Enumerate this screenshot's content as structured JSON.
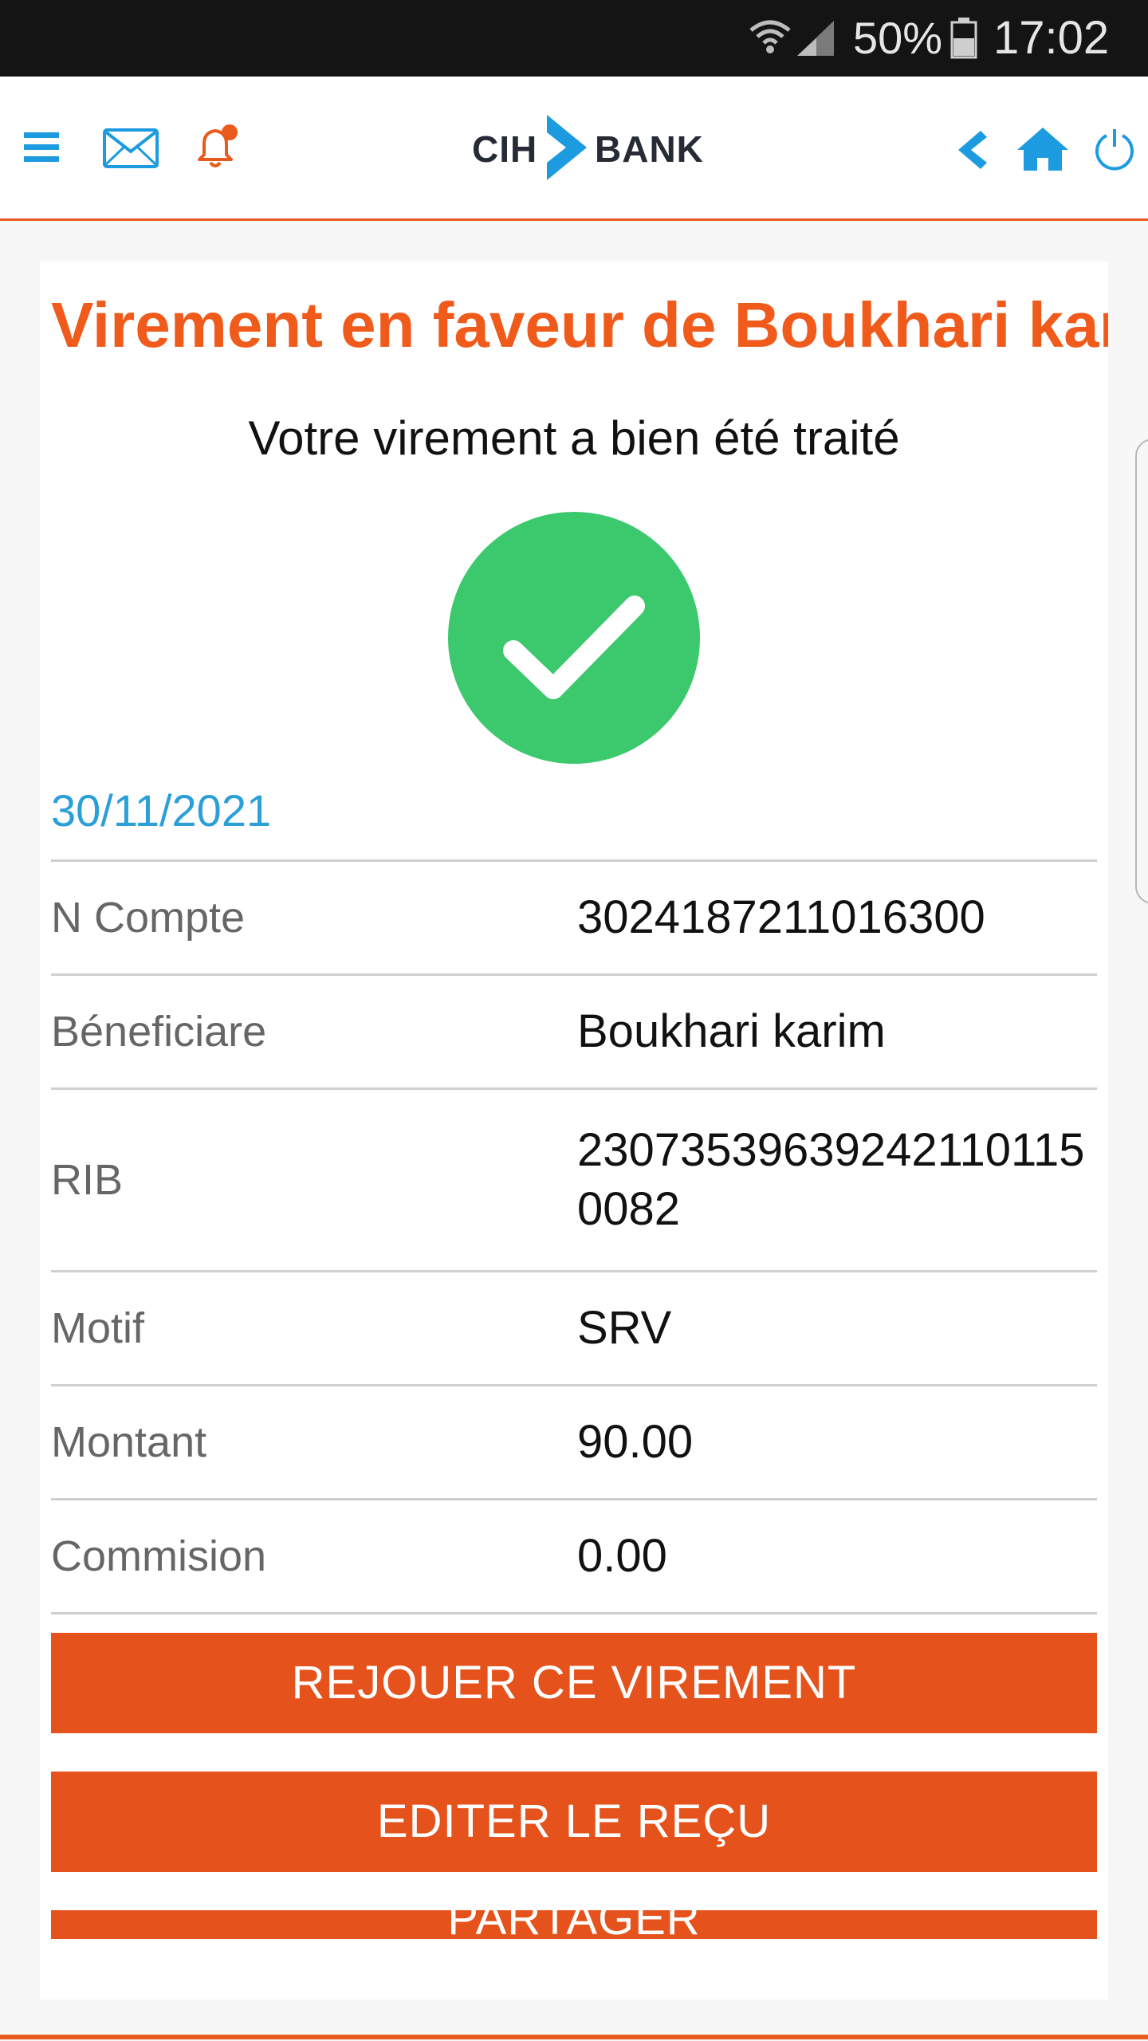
{
  "status_bar": {
    "battery": "50%",
    "time": "17:02",
    "icons": [
      "wifi-icon",
      "signal-icon",
      "battery-icon"
    ]
  },
  "header": {
    "logo_left": "CIH",
    "logo_right": "BANK",
    "icons": [
      "menu-icon",
      "mail-icon",
      "notification-bell-icon",
      "back-arrow-icon",
      "home-icon",
      "power-icon"
    ],
    "colors": {
      "accent_orange": "#e95a1c",
      "icon_blue": "#1d9be0"
    }
  },
  "transfer": {
    "title": "Virement en faveur de Boukhari karim",
    "confirmation": "Votre virement a bien été traité",
    "date": "30/11/2021",
    "rows": [
      {
        "label": "N Compte",
        "value": "3024187211016300"
      },
      {
        "label": "Béneficiare",
        "value": "Boukhari karim"
      },
      {
        "label": "RIB",
        "value": "230735396392421101150082"
      },
      {
        "label": "Motif",
        "value": "SRV"
      },
      {
        "label": "Montant",
        "value": "90.00"
      },
      {
        "label": "Commision",
        "value": "0.00"
      }
    ]
  },
  "actions": {
    "replay": "REJOUER CE VIREMENT",
    "receipt": "EDITER LE REÇU",
    "share": "PARTAGER"
  },
  "colors": {
    "success_green": "#3cc86c",
    "title_orange": "#f05a1a",
    "button_orange": "#e5521b",
    "date_blue": "#2a9fd8"
  }
}
